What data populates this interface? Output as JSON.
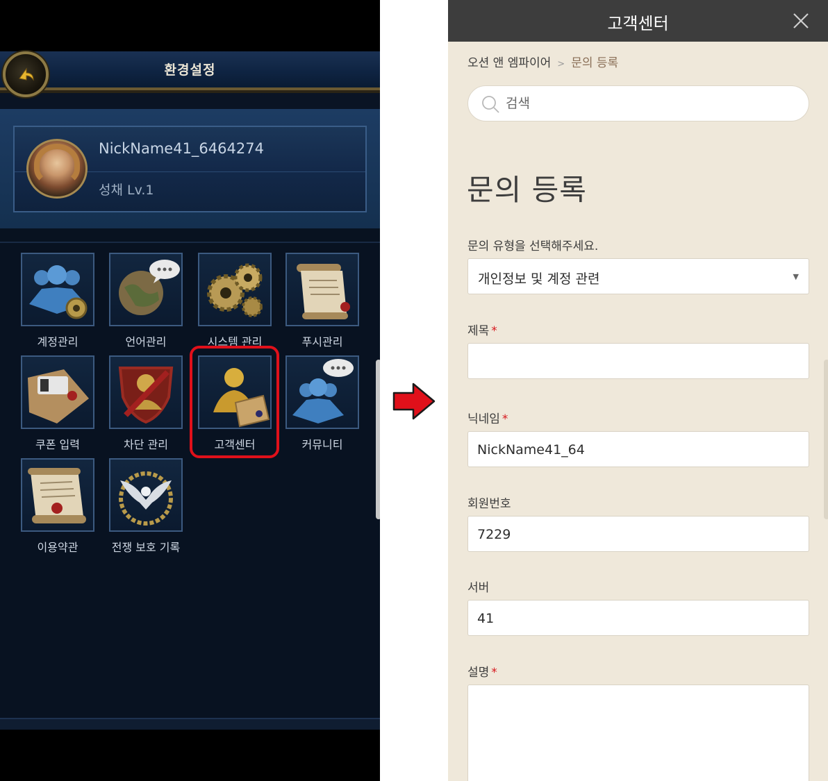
{
  "game": {
    "title": "환경설정",
    "profile": {
      "nickname": "NickName41_6464274",
      "level": "성채 Lv.1"
    },
    "menu": [
      {
        "label": "계정관리",
        "icon": "account-icon"
      },
      {
        "label": "언어관리",
        "icon": "language-globe-icon"
      },
      {
        "label": "시스템 관리",
        "icon": "system-gears-icon"
      },
      {
        "label": "푸시관리",
        "icon": "push-scroll-icon"
      },
      {
        "label": "쿠폰 입력",
        "icon": "coupon-envelope-icon"
      },
      {
        "label": "차단 관리",
        "icon": "block-shield-icon"
      },
      {
        "label": "고객센터",
        "icon": "customer-center-icon"
      },
      {
        "label": "커뮤니티",
        "icon": "community-icon"
      },
      {
        "label": "이용약관",
        "icon": "terms-scroll-icon"
      },
      {
        "label": "전쟁 보호 기록",
        "icon": "war-protection-eagle-icon"
      }
    ],
    "highlight_color": "#e0101a"
  },
  "customer_center": {
    "header_title": "고객센터",
    "breadcrumb": {
      "root": "오션 앤 엠파이어",
      "separator": ">",
      "current": "문의 등록"
    },
    "search": {
      "placeholder": "검색"
    },
    "page_title": "문의 등록",
    "inquiry_type": {
      "label": "문의 유형을 선택해주세요.",
      "selected": "개인정보 및 계정 관련"
    },
    "subject": {
      "label": "제목",
      "required_mark": "*",
      "value": ""
    },
    "nickname": {
      "label": "닉네임",
      "required_mark": "*",
      "value": "NickName41_64"
    },
    "member_no": {
      "label": "회원번호",
      "value": "7229"
    },
    "server": {
      "label": "서버",
      "value": "41"
    },
    "description": {
      "label": "설명",
      "required_mark": "*",
      "value": ""
    },
    "colors": {
      "header_bg": "#3d3d3d",
      "page_bg": "#efe8da",
      "required": "#d7191f",
      "breadcrumb_current": "#8a6f57"
    }
  },
  "transition_arrow_color": "#e0101a"
}
